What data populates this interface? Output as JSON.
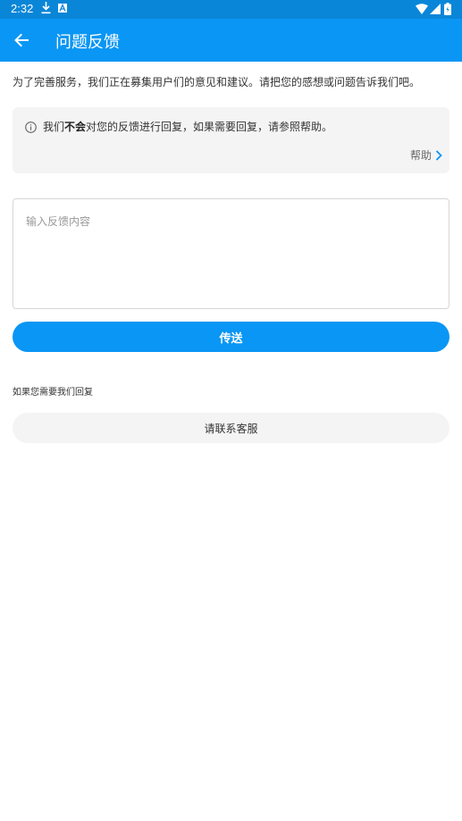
{
  "status_bar": {
    "time": "2:32",
    "icons": [
      "download-icon",
      "a-icon",
      "wifi-icon",
      "signal-icon",
      "battery-icon"
    ]
  },
  "app_bar": {
    "title": "问题反馈",
    "back_icon": "arrow-left-icon"
  },
  "intro_text": "为了完善服务，我们正在募集用户们的意见和建议。请把您的感想或问题告诉我们吧。",
  "notice": {
    "text_before": "我们",
    "text_bold": "不会",
    "text_after": "对您的反馈进行回复，如果需要回复，请参照帮助。",
    "help_label": "帮助"
  },
  "feedback": {
    "placeholder": "输入反馈内容",
    "value": ""
  },
  "send_button": "传送",
  "reply_label": "如果您需要我们回复",
  "contact_button": "请联系客服",
  "colors": {
    "status_bar": "#0a86d8",
    "app_bar": "#0a96f4",
    "primary_button": "#0a96f4",
    "notice_bg": "#f4f4f4"
  }
}
